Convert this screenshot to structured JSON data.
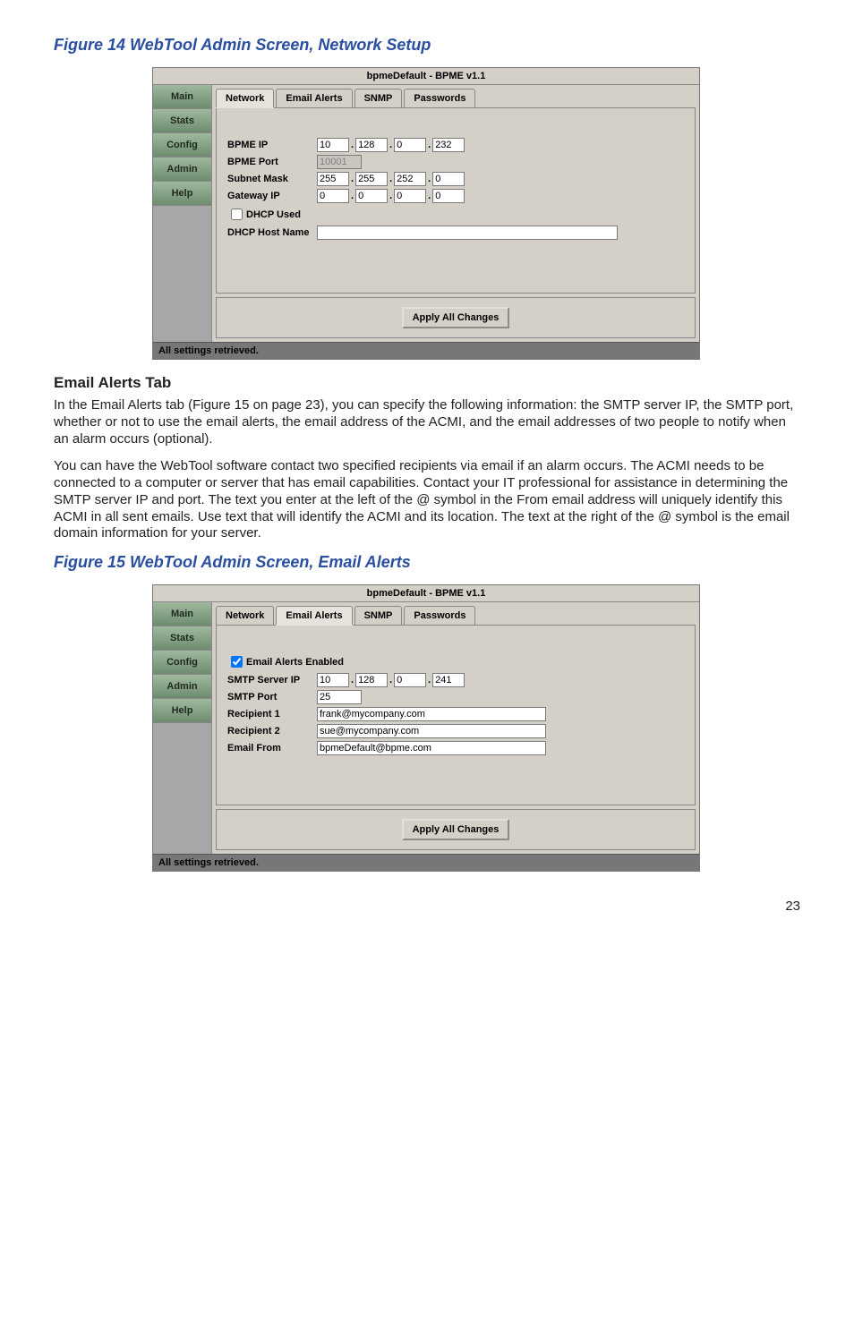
{
  "fig14_caption": "Figure 14    WebTool Admin Screen, Network Setup",
  "fig15_caption": "Figure 15    WebTool Admin Screen, Email Alerts",
  "section_heading": "Email Alerts Tab",
  "para1": "In the Email Alerts tab (Figure 15 on page 23), you can specify the following information: the SMTP server IP, the SMTP port, whether or not to use the email alerts, the email address of the ACMI, and the email addresses of two people to notify when an alarm occurs (optional).",
  "para2": "You can have the WebTool software contact two specified recipients via email if an alarm occurs. The ACMI needs to be connected to a computer or server that has email capabilities. Contact your IT professional for assistance in determining the SMTP server IP and port. The text you enter at the left of the @ symbol in the From email address will uniquely identify this ACMI in all sent emails. Use text that will identify the ACMI and its location. The text at the right of the @ symbol is the email domain information for your server.",
  "page_number": "23",
  "vtabs": {
    "main": "Main",
    "stats": "Stats",
    "config": "Config",
    "admin": "Admin",
    "help": "Help"
  },
  "app1": {
    "title": "bpmeDefault - BPME v1.1",
    "htabs": {
      "network": "Network",
      "email": "Email Alerts",
      "snmp": "SNMP",
      "passwords": "Passwords"
    },
    "labels": {
      "bpme_ip": "BPME IP",
      "bpme_port": "BPME Port",
      "subnet": "Subnet Mask",
      "gateway": "Gateway IP",
      "dhcp_used": "DHCP Used",
      "dhcp_host": "DHCP Host Name"
    },
    "bpme_ip": [
      "10",
      "128",
      "0",
      "232"
    ],
    "bpme_port": "10001",
    "subnet": [
      "255",
      "255",
      "252",
      "0"
    ],
    "gateway": [
      "0",
      "0",
      "0",
      "0"
    ],
    "dhcp_used": false,
    "dhcp_host": "",
    "apply": "Apply All Changes",
    "status": "All settings retrieved."
  },
  "app2": {
    "title": "bpmeDefault - BPME v1.1",
    "htabs": {
      "network": "Network",
      "email": "Email Alerts",
      "snmp": "SNMP",
      "passwords": "Passwords"
    },
    "labels": {
      "enabled": "Email Alerts Enabled",
      "smtp_ip": "SMTP Server IP",
      "smtp_port": "SMTP Port",
      "r1": "Recipient 1",
      "r2": "Recipient 2",
      "from": "Email From"
    },
    "enabled": true,
    "smtp_ip": [
      "10",
      "128",
      "0",
      "241"
    ],
    "smtp_port": "25",
    "r1": "frank@mycompany.com",
    "r2": "sue@mycompany.com",
    "from": "bpmeDefault@bpme.com",
    "apply": "Apply All Changes",
    "status": "All settings retrieved."
  }
}
